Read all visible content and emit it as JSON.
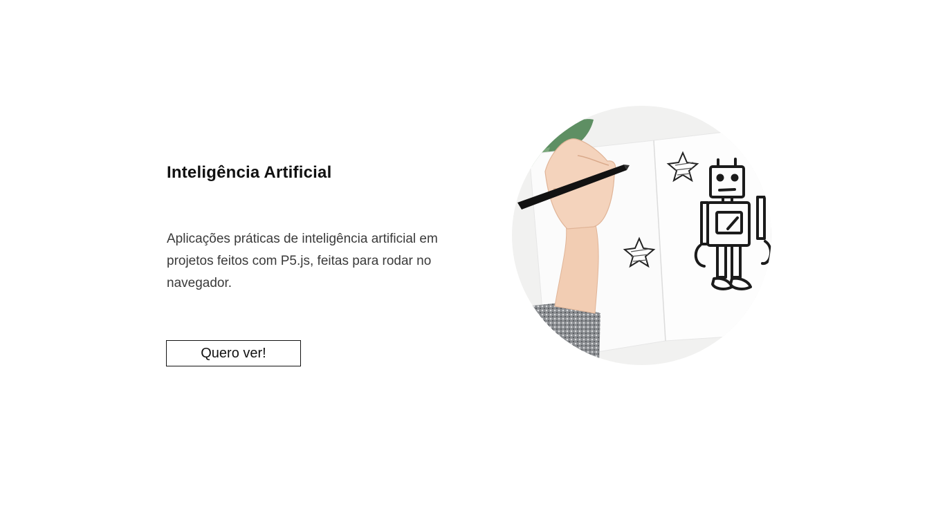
{
  "hero": {
    "title": "Inteligência Artificial",
    "description": "Aplicações práticas de inteligência artificial em projetos feitos com P5.js, feitas para rodar no navegador.",
    "cta_label": "Quero ver!"
  },
  "illustration": {
    "icon": "hand-drawing-robot-illustration"
  },
  "colors": {
    "background": "#ffffff",
    "text": "#111111",
    "muted_text": "#3a3a3a",
    "button_border": "#111111"
  }
}
